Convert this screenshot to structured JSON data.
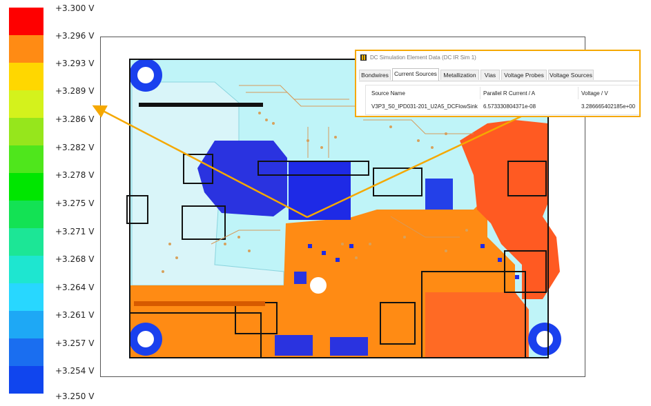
{
  "legend": {
    "labels": [
      "+3.300 V",
      "+3.296 V",
      "+3.293 V",
      "+3.289 V",
      "+3.286 V",
      "+3.282 V",
      "+3.278 V",
      "+3.275 V",
      "+3.271 V",
      "+3.268 V",
      "+3.264 V",
      "+3.261 V",
      "+3.257 V",
      "+3.254 V",
      "+3.250 V"
    ],
    "colors": [
      "#fe0000",
      "#ff4a1c",
      "#ff8b14",
      "#ffd700",
      "#d4f21c",
      "#96e61c",
      "#4fe61c",
      "#00e600",
      "#13e254",
      "#1ce696",
      "#1ee6d0",
      "#28d7ff",
      "#1ea8f5",
      "#1a6ef0",
      "#1045ee"
    ]
  },
  "dialog": {
    "title": "DC Simulation Element Data (DC IR Sim 1)",
    "tabs": [
      "Bondwires",
      "Current Sources",
      "Metallization",
      "Vias",
      "Voltage Probes",
      "Voltage Sources"
    ],
    "active_tab": "Current Sources",
    "columns": [
      "Source Name",
      "Parallel R Current / A",
      "Voltage / V"
    ],
    "row": [
      "V3P3_S0_IPD031-201_U2A5_DCFlowSink",
      "6.573330804371e-08",
      "3.286665402185e+00"
    ]
  },
  "colors": {
    "highlight": "#f5a800",
    "board_base": "#bff4f8",
    "board_outline": "#111111",
    "copper_orange": "#ff8b14",
    "copper_red_orange": "#ff4a1c",
    "copper_blue": "#1e2ae6"
  }
}
